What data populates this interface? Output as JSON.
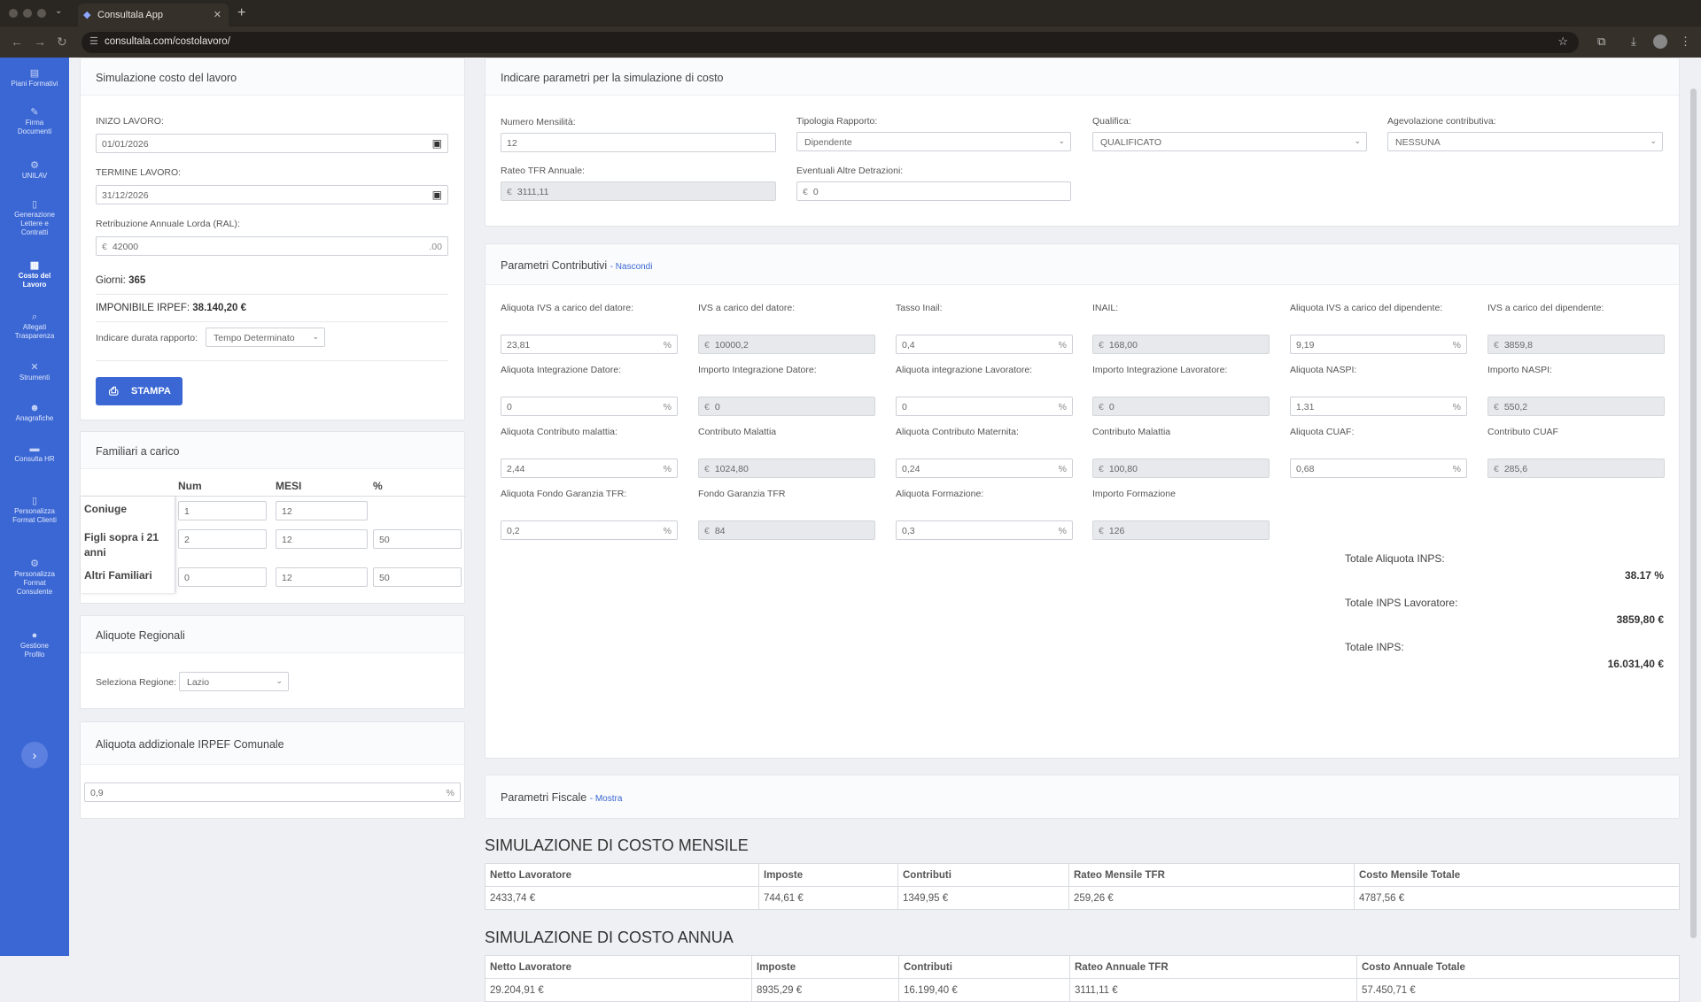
{
  "browser": {
    "tab_title": "Consultala App",
    "url": "consultala.com/costolavoro/"
  },
  "sidebar": {
    "items": [
      {
        "label": "Piani Formativi",
        "icon": "book-icon"
      },
      {
        "label": "Firma Documenti",
        "icon": "pen-icon"
      },
      {
        "label": "UNILAV",
        "icon": "gear-icon"
      },
      {
        "label": "Generazione Lettere e Contratti",
        "icon": "file-icon"
      },
      {
        "label": "Costo del Lavoro",
        "icon": "calculator-icon"
      },
      {
        "label": "Allegati Trasparenza",
        "icon": "search-icon"
      },
      {
        "label": "Strumenti",
        "icon": "tools-icon"
      },
      {
        "label": "Anagrafiche",
        "icon": "users-icon"
      },
      {
        "label": "Consulta HR",
        "icon": "folder-icon"
      },
      {
        "label": "Personalizza Format Clienti",
        "icon": "file-icon"
      },
      {
        "label": "Personalizza Format Consulente",
        "icon": "gear-icon"
      },
      {
        "label": "Gestione Profilo",
        "icon": "user-icon"
      }
    ]
  },
  "sim": {
    "title": "Simulazione costo del lavoro",
    "inizio_label": "INIZO LAVORO:",
    "inizio_value": "01/01/2026",
    "termine_label": "TERMINE LAVORO:",
    "termine_value": "31/12/2026",
    "ral_label": "Retribuzione Annuale Lorda (RAL):",
    "ral_prefix": "€",
    "ral_value": "42000",
    "ral_suffix": ".00",
    "giorni_label": "Giorni:",
    "giorni_value": "365",
    "imponibile_label": "IMPONIBILE IRPEF:",
    "imponibile_value": "38.140,20 €",
    "durata_label": "Indicare durata rapporto:",
    "durata_value": "Tempo Determinato",
    "stampa_label": "STAMPA"
  },
  "familiari": {
    "title": "Familiari a carico",
    "headers": [
      "Num",
      "MESI",
      "%"
    ],
    "rows": [
      {
        "label": "Coniuge",
        "num": "1",
        "mesi": "12",
        "pct": ""
      },
      {
        "label": "Figli sopra i 21 anni",
        "num": "2",
        "mesi": "12",
        "pct": "50"
      },
      {
        "label": "Altri Familiari",
        "num": "0",
        "mesi": "12",
        "pct": "50"
      }
    ]
  },
  "regionali": {
    "title": "Aliquote Regionali",
    "regione_label": "Seleziona Regione:",
    "regione_value": "Lazio"
  },
  "comunale": {
    "title": "Aliquota addizionale IRPEF Comunale",
    "value": "0,9",
    "suffix": "%"
  },
  "params": {
    "title": "Indicare parametri per la simulazione di costo",
    "mensilita_label": "Numero Mensilità:",
    "mensilita_value": "12",
    "tipologia_label": "Tipologia Rapporto:",
    "tipologia_value": "Dipendente",
    "qualifica_label": "Qualifica:",
    "qualifica_value": "QUALIFICATO",
    "agevolazione_label": "Agevolazione contributiva:",
    "agevolazione_value": "NESSUNA",
    "rateo_label": "Rateo TFR Annuale:",
    "rateo_value": "3111,11",
    "detrazioni_label": "Eventuali Altre Detrazioni:",
    "detrazioni_value": "0",
    "currency": "€"
  },
  "contributivi": {
    "title": "Parametri Contributivi",
    "toggle": "- Nascondi",
    "fields": [
      {
        "label": "Aliquota IVS a carico del datore:",
        "value": "23,81",
        "kind": "pct"
      },
      {
        "label": "IVS a carico del datore:",
        "value": "10000,2",
        "kind": "eur"
      },
      {
        "label": "Tasso Inail:",
        "value": "0,4",
        "kind": "pct"
      },
      {
        "label": "INAIL:",
        "value": "168,00",
        "kind": "eur"
      },
      {
        "label": "Aliquota IVS a carico del dipendente:",
        "value": "9,19",
        "kind": "pct"
      },
      {
        "label": "IVS a carico del dipendente:",
        "value": "3859,8",
        "kind": "eur"
      },
      {
        "label": "Aliquota Integrazione Datore:",
        "value": "0",
        "kind": "pct"
      },
      {
        "label": "Importo Integrazione Datore:",
        "value": "0",
        "kind": "eur"
      },
      {
        "label": "Aliquota integrazione Lavoratore:",
        "value": "0",
        "kind": "pct"
      },
      {
        "label": "Importo Integrazione Lavoratore:",
        "value": "0",
        "kind": "eur"
      },
      {
        "label": "Aliquota NASPI:",
        "value": "1,31",
        "kind": "pct"
      },
      {
        "label": "Importo NASPI:",
        "value": "550,2",
        "kind": "eur"
      },
      {
        "label": "Aliquota Contributo malattia:",
        "value": "2,44",
        "kind": "pct"
      },
      {
        "label": "Contributo Malattia",
        "value": "1024,80",
        "kind": "eur"
      },
      {
        "label": "Aliquota Contributo Maternita:",
        "value": "0,24",
        "kind": "pct"
      },
      {
        "label": "Contributo Malattia",
        "value": "100,80",
        "kind": "eur"
      },
      {
        "label": "Aliquota CUAF:",
        "value": "0,68",
        "kind": "pct"
      },
      {
        "label": "Contributo CUAF",
        "value": "285,6",
        "kind": "eur"
      },
      {
        "label": "Aliquota Fondo Garanzia TFR:",
        "value": "0,2",
        "kind": "pct"
      },
      {
        "label": "Fondo Garanzia TFR",
        "value": "84",
        "kind": "eur"
      },
      {
        "label": "Aliquota Formazione:",
        "value": "0,3",
        "kind": "pct"
      },
      {
        "label": "Importo Formazione",
        "value": "126",
        "kind": "eur"
      }
    ],
    "totale_aliquota_label": "Totale Aliquota INPS:",
    "totale_aliquota_value": "38.17 %",
    "totale_lavoratore_label": "Totale INPS Lavoratore:",
    "totale_lavoratore_value": "3859,80 €",
    "totale_inps_label": "Totale INPS:",
    "totale_inps_value": "16.031,40 €"
  },
  "fiscale": {
    "title": "Parametri Fiscale",
    "toggle": "- Mostra"
  },
  "mensile": {
    "title": "SIMULAZIONE DI COSTO MENSILE",
    "headers": [
      "Netto Lavoratore",
      "Imposte",
      "Contributi",
      "Rateo Mensile TFR",
      "Costo Mensile Totale"
    ],
    "values": [
      "2433,74 €",
      "744,61 €",
      "1349,95 €",
      "259,26 €",
      "4787,56 €"
    ]
  },
  "annua": {
    "title": "SIMULAZIONE DI COSTO ANNUA",
    "headers": [
      "Netto Lavoratore",
      "Imposte",
      "Contributi",
      "Rateo Annuale TFR",
      "Costo Annuale Totale"
    ],
    "values": [
      "29.204,91 €",
      "8935,29 €",
      "16.199,40 €",
      "3111,11 €",
      "57.450,71 €"
    ]
  }
}
